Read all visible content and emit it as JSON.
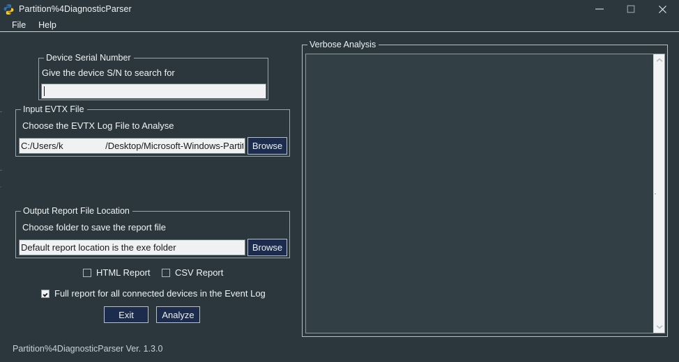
{
  "window": {
    "title": "Partition%4DiagnosticParser",
    "icon": "python-logo-icon",
    "controls": {
      "minimize": "minimize-icon",
      "maximize": "maximize-icon",
      "close": "close-icon"
    }
  },
  "menubar": {
    "items": [
      {
        "label": "File"
      },
      {
        "label": "Help"
      }
    ]
  },
  "serial_group": {
    "legend": "Device Serial Number",
    "hint": "Give the device S/N to search for",
    "input": {
      "value": "",
      "placeholder": ""
    }
  },
  "input_evtx_group": {
    "legend": "Input EVTX File",
    "hint": "Choose the EVTX Log File to Analyse",
    "input": {
      "value_prefix": "C:/Users/k",
      "value_redacted": true,
      "value_suffix": "/Desktop/Microsoft-Windows-Partitio",
      "full_display": "C:/Users/k          /Desktop/Microsoft-Windows-Partitio"
    },
    "browse_label": "Browse"
  },
  "output_group": {
    "legend": "Output Report File Location",
    "hint": "Choose folder to save the report file",
    "input": {
      "value": "Default report location is the exe folder"
    },
    "browse_label": "Browse"
  },
  "options": {
    "html_report": {
      "label": "HTML Report",
      "checked": false
    },
    "csv_report": {
      "label": "CSV Report",
      "checked": false
    },
    "full_report": {
      "label": "Full report for all connected devices in the Event Log",
      "checked": true
    }
  },
  "actions": {
    "exit_label": "Exit",
    "analyze_label": "Analyze"
  },
  "verbose_group": {
    "legend": "Verbose Analysis",
    "content": "",
    "scrollbar": {
      "up_icon": "chevron-up-icon",
      "down_icon": "chevron-down-icon"
    }
  },
  "status_bar": {
    "text": "Partition%4DiagnosticParser Ver. 1.3.0"
  },
  "colors": {
    "window_bg": "#2b373c",
    "text": "#eef3f6",
    "button_bg": "#1d2b4d",
    "border": "#9aa6ac",
    "input_bg": "#f0f1f3",
    "textarea_bg": "#324045",
    "scrollbar_bg": "#f2f3f4",
    "status_text": "#c6d2d8"
  }
}
